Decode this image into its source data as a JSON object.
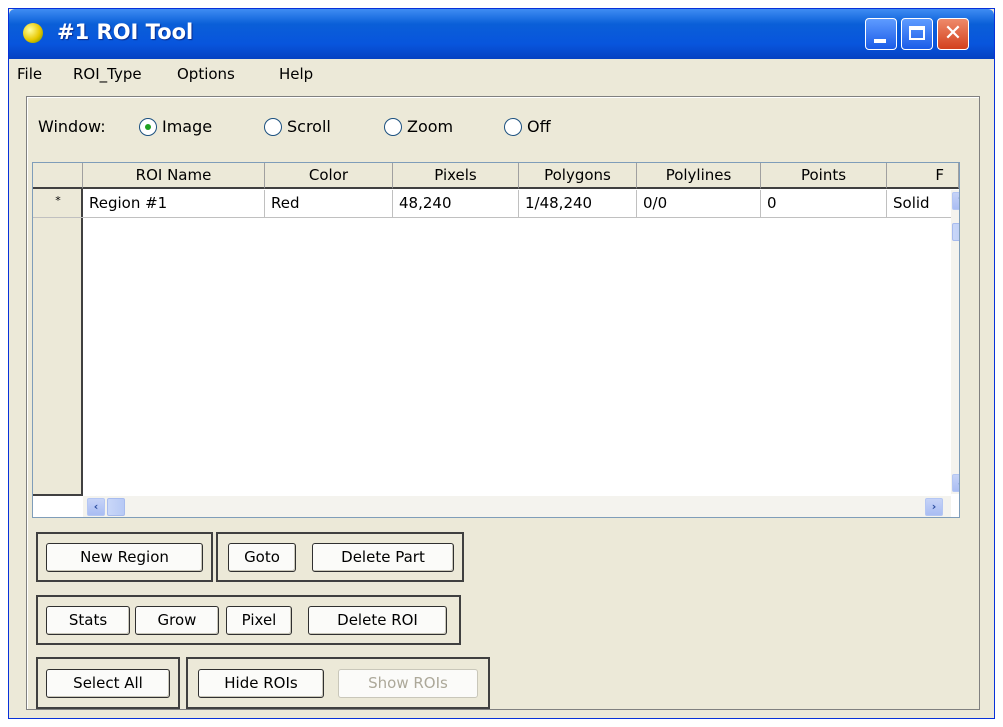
{
  "window": {
    "title": "#1 ROI Tool"
  },
  "menu": [
    "File",
    "ROI_Type",
    "Options",
    "Help"
  ],
  "window_selector": {
    "label": "Window:",
    "options": [
      "Image",
      "Scroll",
      "Zoom",
      "Off"
    ],
    "selected": "Image"
  },
  "table": {
    "columns": [
      "ROI Name",
      "Color",
      "Pixels",
      "Polygons",
      "Polylines",
      "Points",
      "F"
    ],
    "rows": [
      {
        "marker": "*",
        "cells": [
          "Region #1",
          "Red",
          "48,240",
          "1/48,240",
          "0/0",
          "0",
          "Solid"
        ]
      }
    ]
  },
  "buttons": {
    "new_region": "New Region",
    "goto": "Goto",
    "delete_part": "Delete Part",
    "stats": "Stats",
    "grow": "Grow",
    "pixel": "Pixel",
    "delete_roi": "Delete ROI",
    "select_all": "Select All",
    "hide_rois": "Hide ROIs",
    "show_rois": "Show ROIs"
  },
  "icons": {
    "app": "roi-tool-icon",
    "minimize": "minimize-icon",
    "maximize": "maximize-icon",
    "close": "close-icon",
    "scroll_up": "chevron-up-icon",
    "scroll_down": "chevron-down-icon",
    "scroll_left": "chevron-left-icon",
    "scroll_right": "chevron-right-icon"
  }
}
